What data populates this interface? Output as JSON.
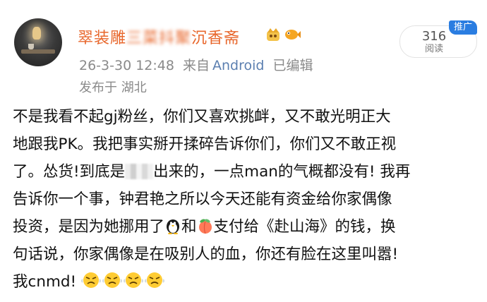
{
  "post": {
    "username_visible_start": "翠装雕",
    "username_blurred": "三菜抖聚",
    "username_visible_end": "沉香斋",
    "timestamp": "26-3-30 12:48",
    "source_prefix": "来自",
    "source": "Android",
    "edited": "已编辑",
    "location": "发布于 湖北",
    "read_count": "316",
    "read_label": "阅读",
    "promo_tag": "推广",
    "icons": [
      "crown-icon",
      "fish-icon",
      "penguin-icon",
      "peach-icon",
      "angry-face-icon"
    ],
    "body": {
      "line1": "不是我看不起gj粉丝，你们又喜欢挑衅，又不敢光明正大",
      "line2": "地跟我PK。我把事实掰开揉碎告诉你们，你们又不敢正视",
      "line3_a": "了。怂货!到底是",
      "line3_b": "出来的，一点man的气概都没有! 我再",
      "line4": "告诉你一个事，钟君艳之所以今天还能有资金给你家偶像",
      "line5_a": "投资，是因为她挪用了",
      "line5_b": "和",
      "line5_c": "支付给《赴山海》的钱，换",
      "line6": "句话说，你家偶像是在吸别人的血，你还有脸在这里叫嚣!",
      "line7": "我cnmd!"
    }
  }
}
